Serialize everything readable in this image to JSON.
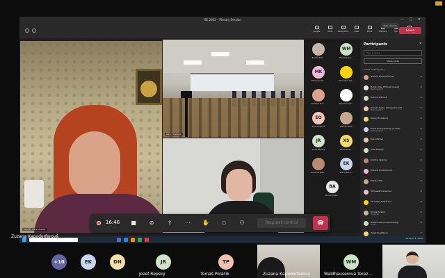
{
  "window": {
    "title": "ISE 2022 – Plenary Session",
    "controls": "— ▢ ✕",
    "share_pill": "Stop sharing"
  },
  "toolbar": {
    "tools": [
      "People",
      "Chat",
      "Reactions",
      "View",
      "More",
      "Camera",
      "Mic",
      "Share"
    ],
    "leave_label": "Leave"
  },
  "tiles": {
    "room_label": "Dávid Stefanik",
    "woman_label": "Danyliv Olha (Guest)"
  },
  "thumbnails": [
    {
      "initials": "",
      "name": "Tomáš Polá...",
      "color": "#c7b6a8"
    },
    {
      "initials": "WM",
      "name": "Waldhauser...",
      "color": "#c9e4c5"
    },
    {
      "initials": "MK",
      "name": "Michaela Kr...",
      "color": "#f2b8d9"
    },
    {
      "initials": "",
      "name": "Miroslava Ra...",
      "color": "#ffd400"
    },
    {
      "initials": "",
      "name": "Kristína Hru...",
      "color": "#d9a38a"
    },
    {
      "initials": "",
      "name": "Diana Pinde...",
      "color": "#ffffff"
    },
    {
      "initials": "EO",
      "name": "Eva Oldřová",
      "color": "#f7c3b5"
    },
    {
      "initials": "",
      "name": "Marián Tóth",
      "color": "#c8a88c"
    },
    {
      "initials": "JR",
      "name": "Jozef Repský",
      "color": "#cfe3c6"
    },
    {
      "initials": "XS",
      "name": "Xénia Svet...",
      "color": "#f6d86c"
    },
    {
      "initials": "",
      "name": "Kristína Igaz...",
      "color": "#b88a6e"
    },
    {
      "initials": "EK",
      "name": "Elena Korn...",
      "color": "#c8d6f0"
    },
    {
      "initials": "BA",
      "name": "Burak Alisa...",
      "color": "#e8e8e8"
    }
  ],
  "participants_panel": {
    "title": "Participants",
    "close": "✕",
    "search_placeholder": "Type a name",
    "share_invite": "Share invite",
    "in_meeting": "In this meeting (77)",
    "rows": [
      {
        "name": "Zuzana Kapodorferová",
        "sub": "",
        "color": "#d9a38a"
      },
      {
        "name": "Burak Alisa (Vrtnej) (Guest)",
        "sub": "Meeting guest",
        "color": "#e8e8e8"
      },
      {
        "name": "Dianna Tóthová",
        "sub": "",
        "color": "#c9e4c5"
      },
      {
        "name": "Danyliv Nadia (Vrtnej) (Guest)",
        "sub": "Meeting guest",
        "color": "#f7c3b5"
      },
      {
        "name": "Diana Pindešová",
        "sub": "",
        "color": "#f6d86c"
      },
      {
        "name": "Elena Korkar(Vrtnej) (Guest)",
        "sub": "Meeting guest",
        "color": "#c8d6f0"
      },
      {
        "name": "Eva Oldřová",
        "sub": "",
        "color": "#f7c3b5"
      },
      {
        "name": "Jozef Repský",
        "sub": "",
        "color": "#cfe3c6"
      },
      {
        "name": "Kristína Igazová",
        "sub": "",
        "color": "#b88a6e"
      },
      {
        "name": "Kristína Predaniková",
        "sub": "",
        "color": "#f2b8d9"
      },
      {
        "name": "Marián Tóth",
        "sub": "",
        "color": "#c8a88c"
      },
      {
        "name": "Michaela Kreslerová",
        "sub": "",
        "color": "#f2b8d9"
      },
      {
        "name": "Miroslava Rajčárová",
        "sub": "",
        "color": "#ffd400"
      },
      {
        "name": "Tomáš Poláčik",
        "sub": "Organizer",
        "color": "#c7b6a8"
      },
      {
        "name": "Waldhauserová Tereza Mgr.",
        "sub": "Guest",
        "color": "#c9e4c5"
      },
      {
        "name": "Xénia Svetlíková",
        "sub": "",
        "color": "#f6d86c"
      }
    ]
  },
  "controls": {
    "time": "16:46",
    "request_control": "Request control",
    "hangup_icon": "☎"
  },
  "share_taskbar": {
    "clock": "10:28\n9. 5. 2022"
  },
  "presenter_label": "Zuzana Kapodorferová",
  "gallery": {
    "more_count": "+10",
    "avatars": [
      {
        "initials": "EK",
        "color": "#c8d6f0"
      },
      {
        "initials": "DN",
        "color": "#f6e0a8"
      }
    ],
    "names": [
      {
        "initials": "JR",
        "name": "Jozef Repský",
        "color": "#cfe3c6"
      },
      {
        "initials": "TP",
        "name": "Tomáš Poláčik",
        "color": "#f2c2b0"
      },
      {
        "initials": "",
        "name": "Zuzana Kapodorferová",
        "color": ""
      },
      {
        "initials": "WM",
        "name": "Waldhauserová Terez...",
        "color": "#c9e4c5"
      }
    ]
  },
  "colors": {
    "accent_red": "#c4314b",
    "more_purple": "#6264a7"
  }
}
